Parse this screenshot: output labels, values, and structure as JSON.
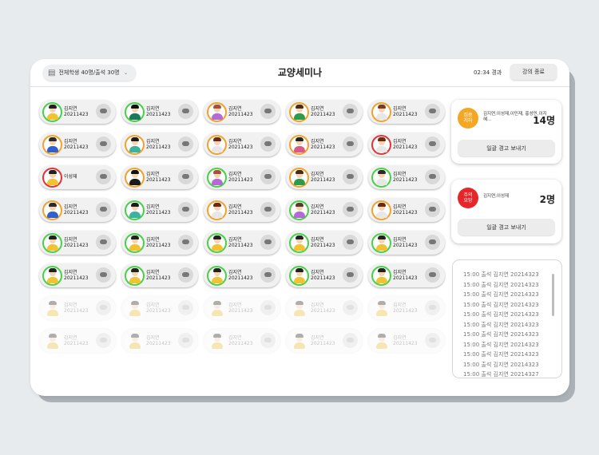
{
  "header": {
    "summary": "전체학생 40명/출석 30명",
    "title": "교양세미나",
    "elapsed": "02:34 경과",
    "end_label": "강의 종료"
  },
  "students": [
    {
      "name": "김지연",
      "id": "20211423",
      "status": "green",
      "body": "#f1c232",
      "hair": "#222"
    },
    {
      "name": "김지연",
      "id": "20211423",
      "status": "green",
      "body": "#1a7a5a",
      "hair": "#111"
    },
    {
      "name": "김지연",
      "id": "20211423",
      "status": "orange",
      "body": "#b46ad6",
      "hair": "#a8513a"
    },
    {
      "name": "김지연",
      "id": "20211423",
      "status": "orange",
      "body": "#2e9a4e",
      "hair": "#4a2a14"
    },
    {
      "name": "김지연",
      "id": "20211423",
      "status": "orange",
      "body": "#e7e7e7",
      "hair": "#7a3b1e"
    },
    {
      "name": "김지연",
      "id": "20211423",
      "status": "orange",
      "body": "#2f5fd0",
      "hair": "#2b2b2b"
    },
    {
      "name": "김지연",
      "id": "20211423",
      "status": "orange",
      "body": "#3bb3a3",
      "hair": "#1b1b1b"
    },
    {
      "name": "김지연",
      "id": "20211423",
      "status": "orange",
      "body": "#e7e7e7",
      "hair": "#6b2a14"
    },
    {
      "name": "김지연",
      "id": "20211423",
      "status": "orange",
      "body": "#d85a8a",
      "hair": "#222"
    },
    {
      "name": "김지연",
      "id": "20211423",
      "status": "red",
      "body": "#e7e7e7",
      "hair": "#6b2a14"
    },
    {
      "name": "이성재",
      "id": "",
      "status": "red",
      "body": "#f1c232",
      "hair": "#222"
    },
    {
      "name": "김지연",
      "id": "20211423",
      "status": "orange",
      "body": "#1a1a1a",
      "hair": "#111"
    },
    {
      "name": "김지연",
      "id": "20211423",
      "status": "green",
      "body": "#b46ad6",
      "hair": "#a8513a"
    },
    {
      "name": "김지연",
      "id": "20211423",
      "status": "orange",
      "body": "#2e9a4e",
      "hair": "#4a2a14"
    },
    {
      "name": "김지연",
      "id": "20211423",
      "status": "green",
      "body": "#e7e7e7",
      "hair": "#2b2b2b"
    },
    {
      "name": "김지연",
      "id": "20211423",
      "status": "orange",
      "body": "#2f5fd0",
      "hair": "#2b2b2b"
    },
    {
      "name": "김지연",
      "id": "20211423",
      "status": "green",
      "body": "#3bb3a3",
      "hair": "#1b1b1b"
    },
    {
      "name": "김지연",
      "id": "20211423",
      "status": "orange",
      "body": "#e7e7e7",
      "hair": "#6b2a14"
    },
    {
      "name": "김지연",
      "id": "20211423",
      "status": "green",
      "body": "#b46ad6",
      "hair": "#5a3a2a"
    },
    {
      "name": "김지연",
      "id": "20211423",
      "status": "orange",
      "body": "#e7e7e7",
      "hair": "#6b2a14"
    },
    {
      "name": "김지연",
      "id": "20211423",
      "status": "green",
      "body": "#f1c232",
      "hair": "#222"
    },
    {
      "name": "김지연",
      "id": "20211423",
      "status": "green",
      "body": "#f1c232",
      "hair": "#222"
    },
    {
      "name": "김지연",
      "id": "20211423",
      "status": "green",
      "body": "#f1c232",
      "hair": "#222"
    },
    {
      "name": "김지연",
      "id": "20211423",
      "status": "green",
      "body": "#f1c232",
      "hair": "#222"
    },
    {
      "name": "김지연",
      "id": "20211423",
      "status": "green",
      "body": "#f1c232",
      "hair": "#222"
    },
    {
      "name": "김지연",
      "id": "20211423",
      "status": "green",
      "body": "#f1c232",
      "hair": "#222"
    },
    {
      "name": "김지연",
      "id": "20211423",
      "status": "green",
      "body": "#f1c232",
      "hair": "#222"
    },
    {
      "name": "김지연",
      "id": "20211423",
      "status": "green",
      "body": "#f1c232",
      "hair": "#222"
    },
    {
      "name": "김지연",
      "id": "20211423",
      "status": "green",
      "body": "#f1c232",
      "hair": "#222"
    },
    {
      "name": "김지연",
      "id": "20211423",
      "status": "green",
      "body": "#f1c232",
      "hair": "#222"
    },
    {
      "name": "김지연",
      "id": "20211423",
      "status": "none",
      "body": "#f1c232",
      "hair": "#222"
    },
    {
      "name": "김지연",
      "id": "20211423",
      "status": "none",
      "body": "#f1c232",
      "hair": "#222"
    },
    {
      "name": "김지연",
      "id": "20211423",
      "status": "none",
      "body": "#f1c232",
      "hair": "#222"
    },
    {
      "name": "김지연",
      "id": "20211423",
      "status": "none",
      "body": "#f1c232",
      "hair": "#222"
    },
    {
      "name": "김지연",
      "id": "20211423",
      "status": "none",
      "body": "#f1c232",
      "hair": "#222"
    },
    {
      "name": "김지연",
      "id": "20211423",
      "status": "none",
      "body": "#f1c232",
      "hair": "#222"
    },
    {
      "name": "김지연",
      "id": "20211423",
      "status": "none",
      "body": "#f1c232",
      "hair": "#222"
    },
    {
      "name": "김지연",
      "id": "20211423",
      "status": "none",
      "body": "#f1c232",
      "hair": "#222"
    },
    {
      "name": "김지연",
      "id": "20211423",
      "status": "none",
      "body": "#f1c232",
      "hair": "#222"
    },
    {
      "name": "김지연",
      "id": "20211423",
      "status": "none",
      "body": "#f1c232",
      "hair": "#222"
    }
  ],
  "focus_panel": {
    "badge": "집중 저하",
    "names": "김지연,이성재,이민재, 홍성민,이지혜...",
    "count": "14명",
    "button": "일괄 경고 보내기",
    "color": "#f5a623"
  },
  "attention_panel": {
    "badge": "주의 요망",
    "names": "김지연,이성재",
    "count": "2명",
    "button": "일괄 경고 보내기",
    "color": "#e8262a"
  },
  "log": [
    "15:00 출석 김지연 20214323",
    "15:00 출석 김지연 20214323",
    "15:00 출석 김지연 20214323",
    "15:00 출석 김지연 20214323",
    "15:00 출석 김지연 20214323",
    "15:00 출석 김지연 20214323",
    "15:00 출석 김지연 20214323",
    "15:00 출석 김지연 20214323",
    "15:00 출석 김지연 20214323",
    "15:00 출석 김지연 20214323",
    "15:00 출석 김지연 20214327"
  ]
}
